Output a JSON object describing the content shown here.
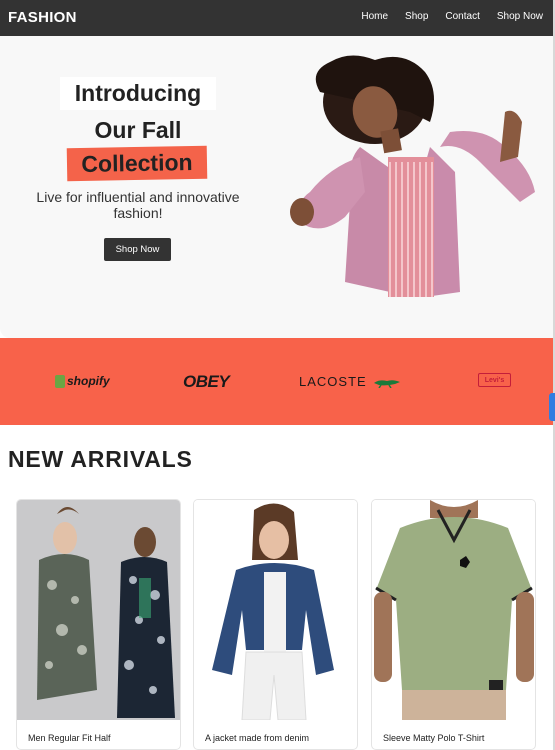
{
  "nav": {
    "brand": "FASHION",
    "links": [
      "Home",
      "Shop",
      "Contact",
      "Shop Now"
    ]
  },
  "hero": {
    "line1": "Introducing",
    "line2": "Our Fall",
    "line3": "Collection",
    "subtitle": "Live for influential and innovative fashion!",
    "button": "Shop Now"
  },
  "brands": [
    "shopify",
    "OBEY",
    "LACOSTE",
    "Levi's"
  ],
  "arrivals": {
    "title": "NEW ARRIVALS",
    "products": [
      {
        "name": "Men Regular Fit Half"
      },
      {
        "name": "A jacket made from denim"
      },
      {
        "name": "Sleeve Matty Polo T-Shirt"
      }
    ]
  },
  "colors": {
    "accent": "#f8624a",
    "nav": "#333333",
    "hero_bg": "#f8f8f8"
  }
}
